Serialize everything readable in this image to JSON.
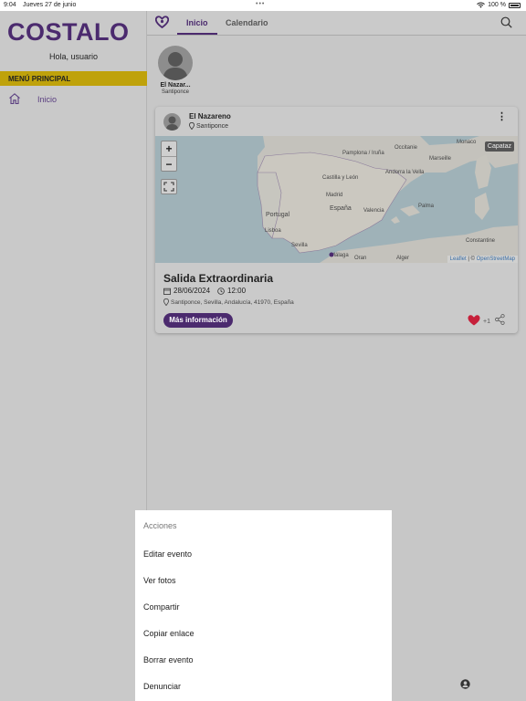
{
  "status": {
    "time": "9:04",
    "date": "Jueves 27 de junio",
    "battery": "100 %"
  },
  "sidebar": {
    "logo": "COSTALO",
    "greeting": "Hola, usuario",
    "menu_header": "MENÚ PRINCIPAL",
    "items": [
      {
        "label": "Inicio",
        "icon": "home-icon"
      }
    ]
  },
  "topnav": {
    "tabs": [
      {
        "label": "Inicio",
        "active": true
      },
      {
        "label": "Calendario",
        "active": false
      }
    ]
  },
  "story": {
    "name": "El Nazar...",
    "place": "Santiponce"
  },
  "card": {
    "author": "El Nazareno",
    "location": "Santiponce",
    "map": {
      "badge": "Capataz",
      "zoom_in": "+",
      "zoom_out": "−",
      "attribution_leaflet": "Leaflet",
      "attribution_sep": " | © ",
      "attribution_osm": "OpenStreetMap",
      "labels": [
        "Pamplona / Iruña",
        "Andorra la Vella",
        "Marseille",
        "Monaco",
        "Occitanie",
        "Castilla y León",
        "Madrid",
        "Valencia",
        "España",
        "Portugal",
        "Lisboa",
        "Sevilla",
        "Málaga",
        "Palma",
        "Alger",
        "Constantine",
        "Oran"
      ]
    },
    "title": "Salida Extraordinaria",
    "date": "28/06/2024",
    "time": "12:00",
    "address": "Santiponce, Sevilla, Andalucía, 41970, España",
    "more_button": "Más información",
    "likes": "+1",
    "accent": "#4b2a6e",
    "like_color": "#c6203a"
  },
  "action_sheet": {
    "title": "Acciones",
    "items": [
      "Editar evento",
      "Ver fotos",
      "Compartir",
      "Copiar enlace",
      "Borrar evento",
      "Denunciar"
    ]
  }
}
